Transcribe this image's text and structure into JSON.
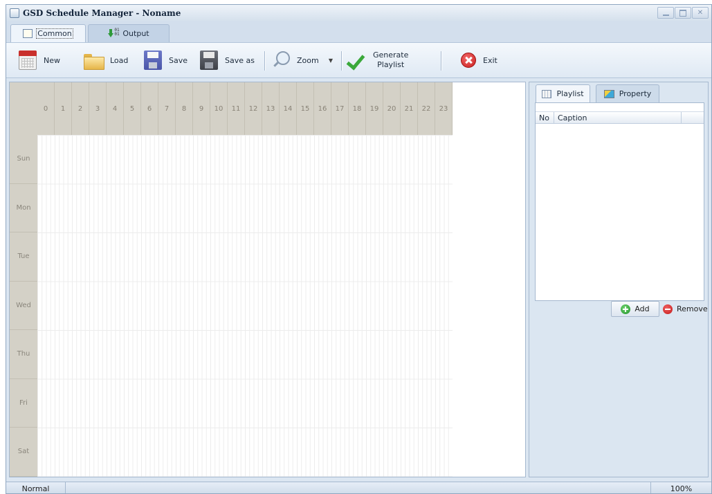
{
  "window": {
    "title": "GSD Schedule Manager - Noname"
  },
  "ribbon_tabs": [
    {
      "label": "Common",
      "icon": "book-icon",
      "active": true
    },
    {
      "label": "Output",
      "icon": "output-icon",
      "active": false
    }
  ],
  "toolbar": {
    "new_label": "New",
    "load_label": "Load",
    "save_label": "Save",
    "saveas_label": "Save as",
    "zoom_label": "Zoom",
    "generate_label_1": "Generate",
    "generate_label_2": "Playlist",
    "exit_label": "Exit"
  },
  "schedule": {
    "hours": [
      "0",
      "1",
      "2",
      "3",
      "4",
      "5",
      "6",
      "7",
      "8",
      "9",
      "10",
      "11",
      "12",
      "13",
      "14",
      "15",
      "16",
      "17",
      "18",
      "19",
      "20",
      "21",
      "22",
      "23"
    ],
    "days": [
      "Sun",
      "Mon",
      "Tue",
      "Wed",
      "Thu",
      "Fri",
      "Sat"
    ]
  },
  "right_panel": {
    "tabs": [
      {
        "label": "Playlist",
        "icon": "playlist-icon",
        "active": true
      },
      {
        "label": "Property",
        "icon": "property-icon",
        "active": false
      }
    ],
    "columns": [
      "No",
      "Caption"
    ],
    "add_label": "Add",
    "remove_label": "Remove"
  },
  "status": {
    "mode": "Normal",
    "zoom": "100%"
  },
  "colors": {
    "grid_header": "#d4d1c7",
    "window_bg": "#dbe6f1",
    "accent_border": "#a5b8cf"
  }
}
